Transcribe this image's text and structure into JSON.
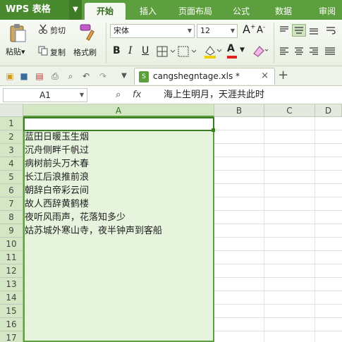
{
  "app": {
    "name": "WPS 表格",
    "menu_arrow": "▼"
  },
  "tabs": [
    "开始",
    "插入",
    "页面布局",
    "公式",
    "数据",
    "审阅"
  ],
  "active_tab": 0,
  "ribbon": {
    "paste": "粘贴",
    "paste_arrow": "▾",
    "cut": "剪切",
    "copy": "复制",
    "format_painter": "格式刷",
    "font_name": "宋体",
    "font_size": "12",
    "grow": "A",
    "shrink": "A",
    "bold": "B",
    "italic": "I",
    "underline": "U",
    "font_color_letter": "A"
  },
  "document": {
    "tab_name": "cangshegntage.xls *",
    "new_tab": "+",
    "close": "×"
  },
  "formula_bar": {
    "cell_ref": "A1",
    "fx": "fx",
    "content": "海上生明月，天涯共此时"
  },
  "columns": [
    "A",
    "B",
    "C",
    "D"
  ],
  "rows": [
    {
      "num": "1",
      "a": "海上生明月，天涯共此时"
    },
    {
      "num": "2",
      "a": "蓝田日暖玉生烟"
    },
    {
      "num": "3",
      "a": "沉舟侧畔千帆过"
    },
    {
      "num": "4",
      "a": "病树前头万木春"
    },
    {
      "num": "5",
      "a": "长江后浪推前浪"
    },
    {
      "num": "6",
      "a": "朝辞白帝彩云间"
    },
    {
      "num": "7",
      "a": "故人西辞黄鹤楼"
    },
    {
      "num": "8",
      "a": "夜听风雨声，花落知多少"
    },
    {
      "num": "9",
      "a": "姑苏城外寒山寺，夜半钟声到客船"
    },
    {
      "num": "10",
      "a": ""
    },
    {
      "num": "11",
      "a": ""
    },
    {
      "num": "12",
      "a": ""
    },
    {
      "num": "13",
      "a": ""
    },
    {
      "num": "14",
      "a": ""
    },
    {
      "num": "15",
      "a": ""
    },
    {
      "num": "16",
      "a": ""
    },
    {
      "num": "17",
      "a": ""
    }
  ],
  "colors": {
    "accent": "#5d9f3e",
    "selection_fill": "#e6f3dd"
  }
}
